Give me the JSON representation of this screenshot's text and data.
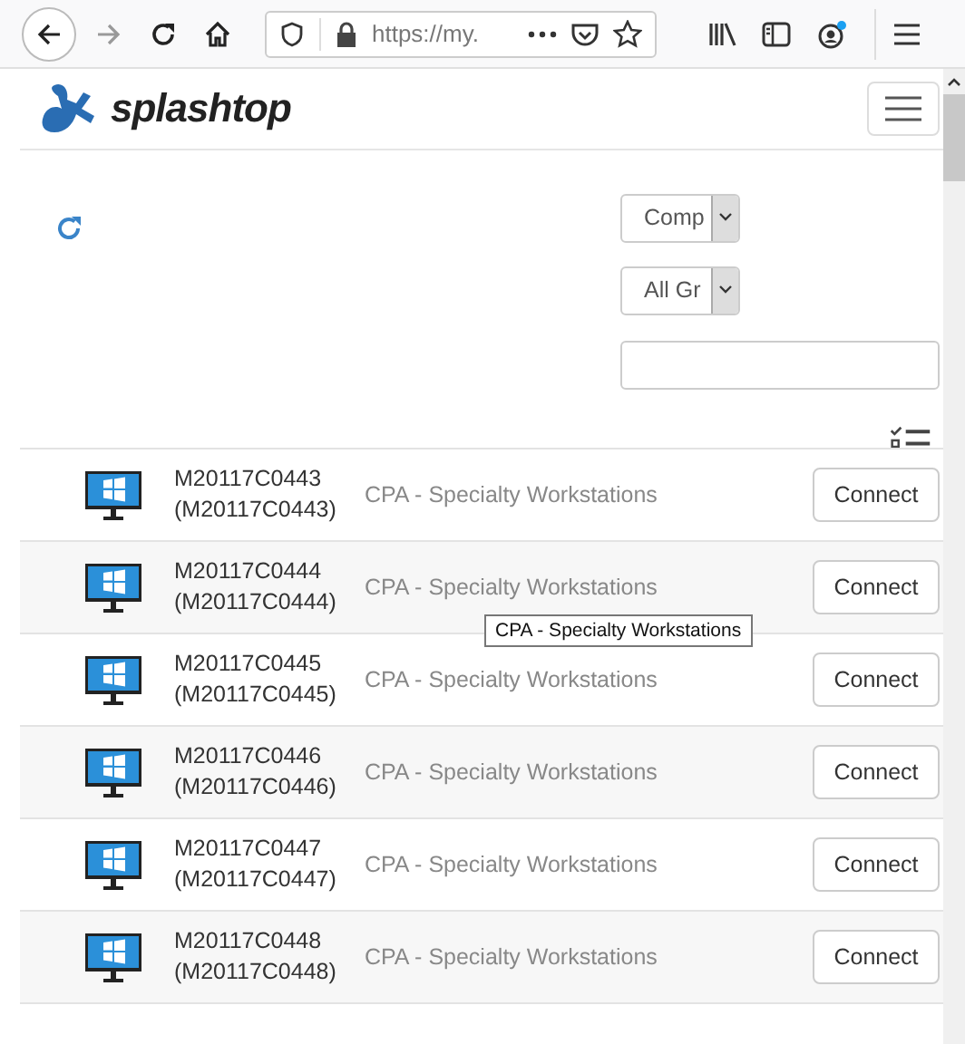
{
  "browser": {
    "url": "https://my."
  },
  "header": {
    "logo": "splashtop"
  },
  "filters": {
    "type_select": "Comp",
    "group_select": "All Gr"
  },
  "computers": [
    {
      "name": "M20117C0443",
      "alias": "(M20117C0443)",
      "group": "CPA - Specialty Workstations",
      "button": "Connect"
    },
    {
      "name": "M20117C0444",
      "alias": "(M20117C0444)",
      "group": "CPA - Specialty Workstations",
      "button": "Connect"
    },
    {
      "name": "M20117C0445",
      "alias": "(M20117C0445)",
      "group": "CPA - Specialty Workstations",
      "button": "Connect"
    },
    {
      "name": "M20117C0446",
      "alias": "(M20117C0446)",
      "group": "CPA - Specialty Workstations",
      "button": "Connect"
    },
    {
      "name": "M20117C0447",
      "alias": "(M20117C0447)",
      "group": "CPA - Specialty Workstations",
      "button": "Connect"
    },
    {
      "name": "M20117C0448",
      "alias": "(M20117C0448)",
      "group": "CPA - Specialty Workstations",
      "button": "Connect"
    }
  ],
  "tooltip": "CPA - Specialty Workstations"
}
